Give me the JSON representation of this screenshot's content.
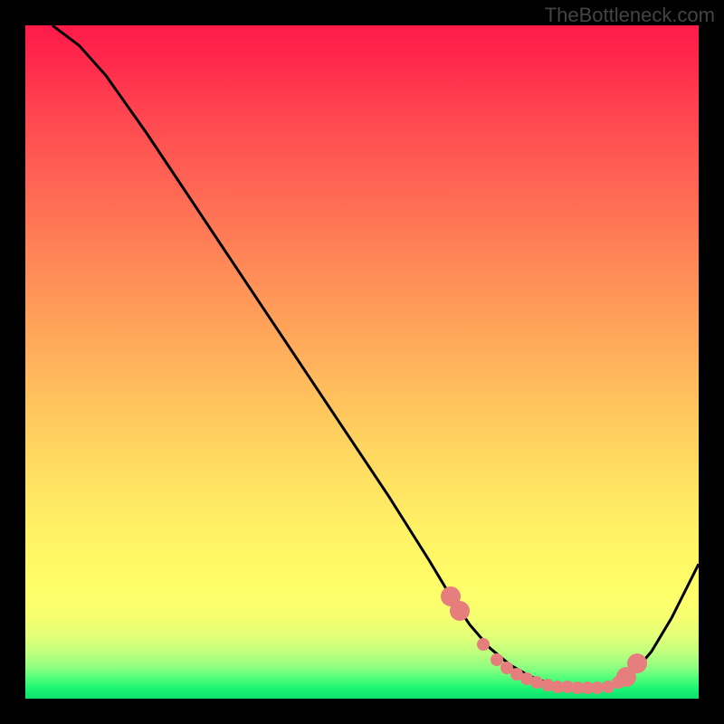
{
  "watermark": "TheBottleneck.com",
  "chart_data": {
    "type": "line",
    "title": "",
    "xlabel": "",
    "ylabel": "",
    "xlim": [
      0,
      100
    ],
    "ylim": [
      0,
      100
    ],
    "series": [
      {
        "name": "curve",
        "x": [
          4,
          8,
          12,
          18,
          24,
          30,
          36,
          42,
          48,
          54,
          60,
          63,
          66,
          69,
          72,
          75,
          78,
          81,
          84,
          86,
          88,
          90,
          93,
          96,
          100
        ],
        "y": [
          100,
          97,
          92.5,
          84,
          75,
          66,
          57,
          48,
          39,
          30,
          20.5,
          15.5,
          11,
          7.5,
          5,
          3.3,
          2.2,
          1.7,
          1.6,
          1.6,
          2.0,
          3.5,
          7,
          12,
          20
        ]
      }
    ],
    "markers": {
      "name": "highlight-dots",
      "color": "#e77e7e",
      "points": [
        {
          "x": 63.2,
          "y": 15.2,
          "big": true
        },
        {
          "x": 64.5,
          "y": 13.0,
          "big": true
        },
        {
          "x": 68.0,
          "y": 8.0,
          "big": false
        },
        {
          "x": 70.0,
          "y": 5.8,
          "big": false
        },
        {
          "x": 71.5,
          "y": 4.6,
          "big": false
        },
        {
          "x": 73.0,
          "y": 3.6,
          "big": false
        },
        {
          "x": 74.5,
          "y": 2.9,
          "big": false
        },
        {
          "x": 76.0,
          "y": 2.4,
          "big": false
        },
        {
          "x": 77.5,
          "y": 2.0,
          "big": false
        },
        {
          "x": 79.0,
          "y": 1.8,
          "big": false
        },
        {
          "x": 80.5,
          "y": 1.7,
          "big": false
        },
        {
          "x": 82.0,
          "y": 1.6,
          "big": false
        },
        {
          "x": 83.5,
          "y": 1.6,
          "big": false
        },
        {
          "x": 85.0,
          "y": 1.6,
          "big": false
        },
        {
          "x": 86.5,
          "y": 1.8,
          "big": false
        },
        {
          "x": 88.0,
          "y": 2.4,
          "big": false
        },
        {
          "x": 89.2,
          "y": 3.2,
          "big": true
        },
        {
          "x": 90.8,
          "y": 5.2,
          "big": true
        }
      ]
    }
  }
}
